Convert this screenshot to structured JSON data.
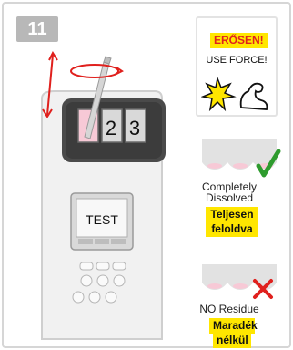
{
  "step_number": "11",
  "meter": {
    "cell_digits": [
      "2",
      "3"
    ],
    "screen_text": "TEST"
  },
  "force_panel": {
    "hungarian": "ERŐSEN!",
    "english": "USE FORCE!"
  },
  "dissolved_panel": {
    "english_line1": "Completely",
    "english_line2": "Dissolved",
    "hungarian_line1": "Teljesen",
    "hungarian_line2": "feloldva",
    "check_color": "#2e9b2e"
  },
  "residue_panel": {
    "english": "NO Residue",
    "hungarian_line1": "Maradék",
    "hungarian_line2": "nélkül",
    "cross_color": "#e0201d"
  },
  "colors": {
    "highlight": "#ffe600",
    "accent_red": "#e0201d",
    "pink_cell": "#f7c9d6"
  }
}
